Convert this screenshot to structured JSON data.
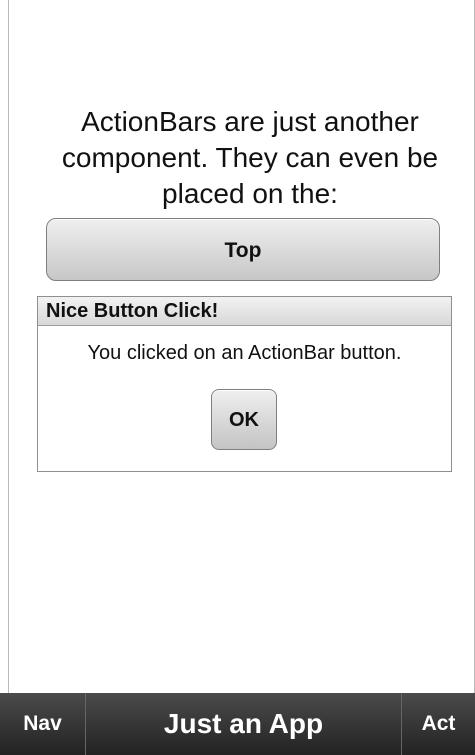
{
  "content": {
    "intro_text": "ActionBars are just another component.   They can even be placed on the:",
    "top_button_label": "Top"
  },
  "dialog": {
    "title": "Nice Button Click!",
    "message": "You clicked on an ActionBar button.",
    "ok_label": "OK"
  },
  "action_bar": {
    "left_label": "Nav",
    "title": "Just an App",
    "right_label": "Act"
  },
  "colors": {
    "action_bar_background": "#2f2f2f",
    "button_gradient_top": "#efefef",
    "button_gradient_bottom": "#c7c7c7",
    "text": "#111111"
  }
}
